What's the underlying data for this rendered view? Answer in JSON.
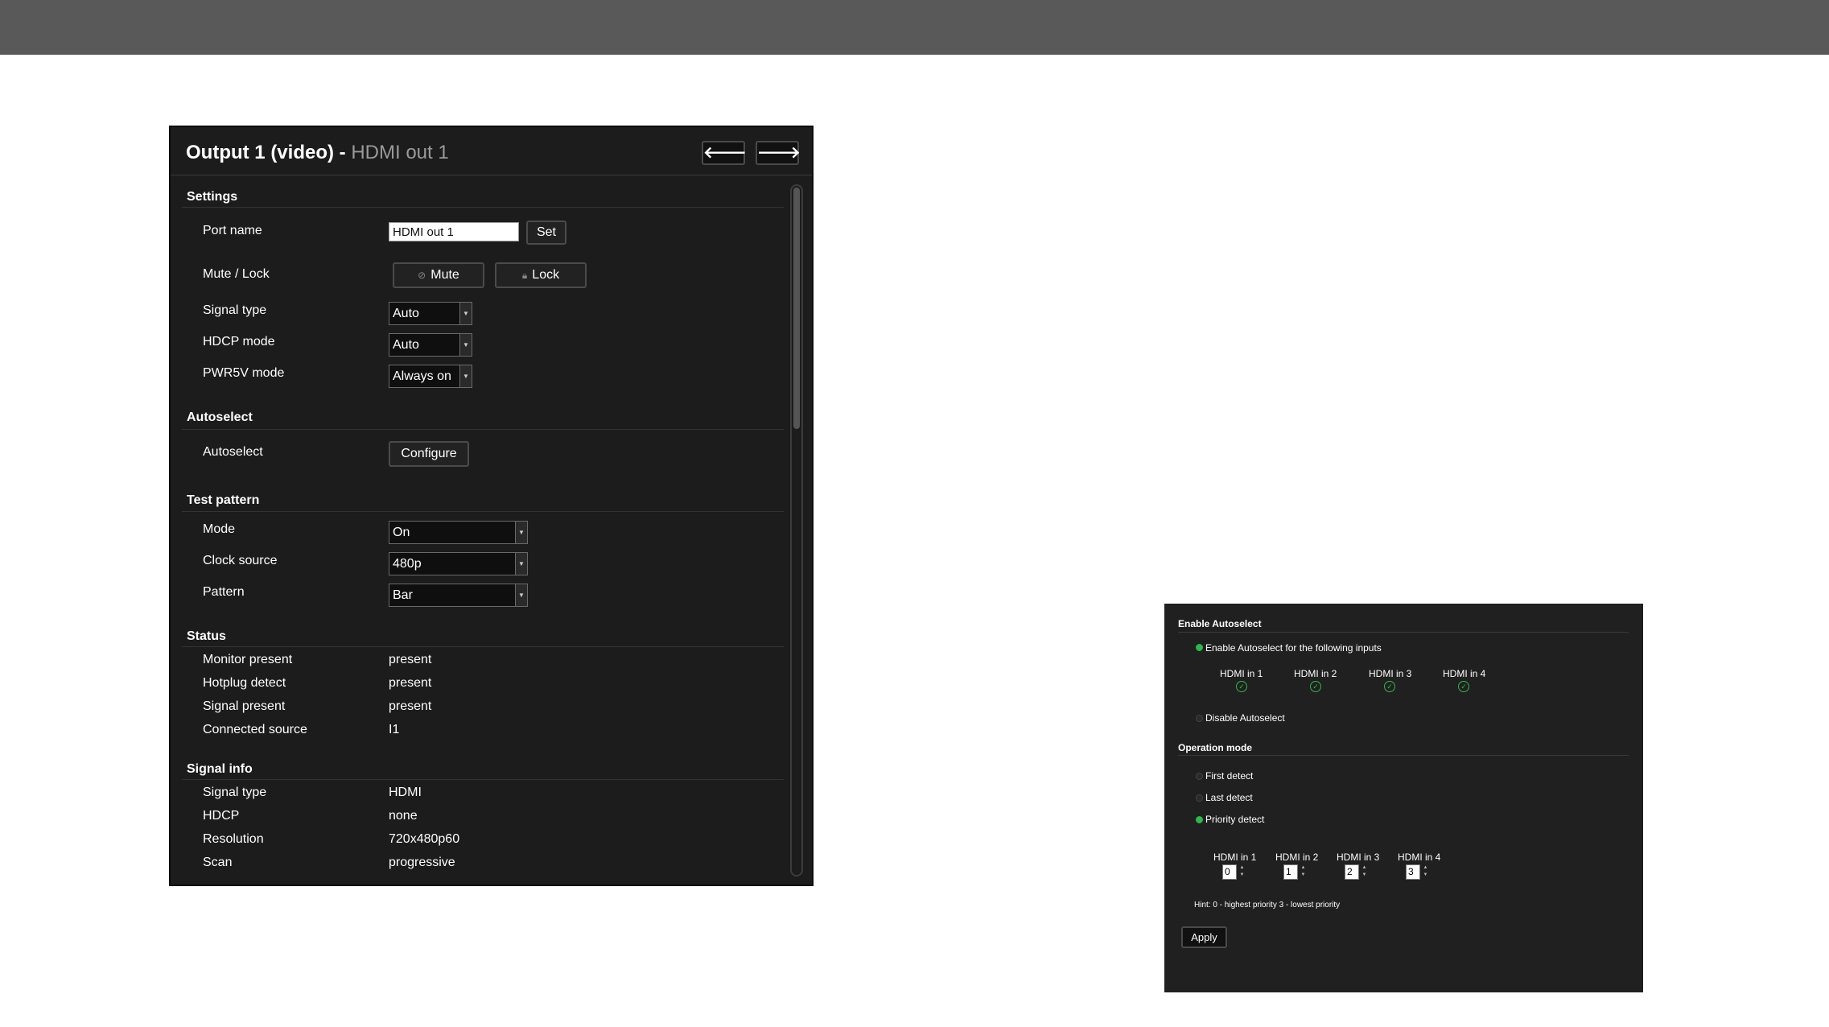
{
  "output_panel": {
    "title": "Output 1 (video) -",
    "subtitle": "HDMI out 1",
    "nav_prev": "🡐",
    "nav_next": "🡒",
    "settings": {
      "heading": "Settings",
      "port_name_label": "Port name",
      "port_name_value": "HDMI out 1",
      "set_button": "Set",
      "mute_lock_label": "Mute / Lock",
      "mute_button": "Mute",
      "lock_button": "Lock",
      "signal_type_label": "Signal type",
      "signal_type_value": "Auto",
      "hdcp_mode_label": "HDCP mode",
      "hdcp_mode_value": "Auto",
      "pwr5v_mode_label": "PWR5V mode",
      "pwr5v_mode_value": "Always on"
    },
    "autoselect": {
      "heading": "Autoselect",
      "label": "Autoselect",
      "configure_button": "Configure"
    },
    "test_pattern": {
      "heading": "Test pattern",
      "mode_label": "Mode",
      "mode_value": "On",
      "clock_source_label": "Clock source",
      "clock_source_value": "480p",
      "pattern_label": "Pattern",
      "pattern_value": "Bar"
    },
    "status": {
      "heading": "Status",
      "rows": [
        {
          "label": "Monitor present",
          "value": "present"
        },
        {
          "label": "Hotplug detect",
          "value": "present"
        },
        {
          "label": "Signal present",
          "value": "present"
        },
        {
          "label": "Connected source",
          "value": "I1"
        }
      ]
    },
    "signal_info": {
      "heading": "Signal info",
      "rows": [
        {
          "label": "Signal type",
          "value": "HDMI"
        },
        {
          "label": "HDCP",
          "value": "none"
        },
        {
          "label": "Resolution",
          "value": "720x480p60"
        },
        {
          "label": "Scan",
          "value": "progressive"
        }
      ]
    }
  },
  "autoselect_panel": {
    "enable_heading": "Enable Autoselect",
    "enable_option": "Enable Autoselect for the following inputs",
    "inputs": [
      "HDMI in 1",
      "HDMI in 2",
      "HDMI in 3",
      "HDMI in 4"
    ],
    "disable_option": "Disable Autoselect",
    "operation_heading": "Operation mode",
    "modes": [
      "First detect",
      "Last detect",
      "Priority detect"
    ],
    "selected_mode": "Priority detect",
    "priority_inputs": [
      "HDMI in 1",
      "HDMI in 2",
      "HDMI in 3",
      "HDMI in 4"
    ],
    "priorities": [
      "0",
      "1",
      "2",
      "3"
    ],
    "hint": "Hint: 0 - highest priority 3 - lowest priority",
    "apply_button": "Apply"
  },
  "colors": {
    "top_bar": "#595959",
    "panel_background": "#1c1c1c",
    "accent_green": "#2fb84a"
  }
}
